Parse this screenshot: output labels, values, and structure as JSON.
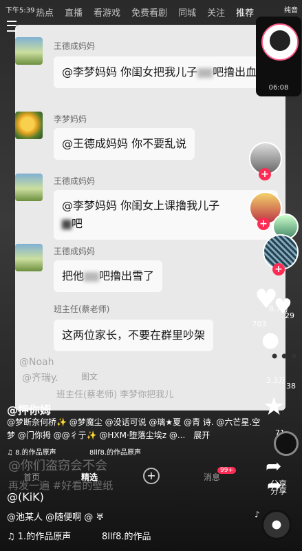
{
  "status_bar": {
    "time": "下午5:39",
    "right_text": "纯音"
  },
  "top_tabs": [
    "热点",
    "直播",
    "看游戏",
    "免费看剧",
    "同城",
    "关注",
    "推荐"
  ],
  "pip": {
    "time": "06:08"
  },
  "chat": {
    "messages": [
      {
        "sender": "王德成妈妈",
        "text_before": "@李梦妈妈 你闺女把我儿子",
        "text_after": "吧撸出血了",
        "avatar": "landscape"
      },
      {
        "sender": "李梦妈妈",
        "text": "@王德成妈妈 你不要乱说",
        "avatar": "sun"
      },
      {
        "sender": "王德成妈妈",
        "text_before": "@李梦妈妈 你闺女上课撸我儿子",
        "text_after": "吧",
        "avatar": "landscape"
      },
      {
        "sender": "王德成妈妈",
        "text_before": "把他",
        "text_after": "吧撸出雪了",
        "avatar": "landscape"
      },
      {
        "sender": "班主任(蔡老师)",
        "text": "这两位家长，不要在群里吵架",
        "avatar": "landscape"
      }
    ],
    "faded": {
      "line1": "@Noah",
      "line2": "@齐瑞y.",
      "tag": "图文",
      "line3": "班主任(蔡老师) 李梦你把我儿"
    }
  },
  "right_rail": {
    "counts": [
      "8.7万",
      "703",
      "29",
      "3.3万",
      "38",
      "分享",
      "71"
    ]
  },
  "bottom": {
    "author": "@押你姆",
    "mentions": "@梦断奈何桥✨ @梦魔尘 @没话可说 @璃★夏 @青 诗. @六芒星.空梦 @门你拇 @@彳亍✨ @HXM·堕落尘埃z @...",
    "expand": "展开",
    "music": "♫ 8.的作品原声",
    "music2": "8llf8.的作品原声",
    "ghost_title": "@你们盗窃会不会",
    "ghost_more": "再发一遍 #好看的壁纸",
    "kik": "@(KiK)",
    "tags": "@池某人 @随便啊 @ ♅",
    "music_bottom": "♫ 1.的作品原声",
    "music_bottom2": "8llf8.的作品"
  },
  "nav": {
    "home": "首页",
    "featured": "精选",
    "plus": "+",
    "messages": "消息",
    "badge": "99+",
    "share": "分享"
  }
}
